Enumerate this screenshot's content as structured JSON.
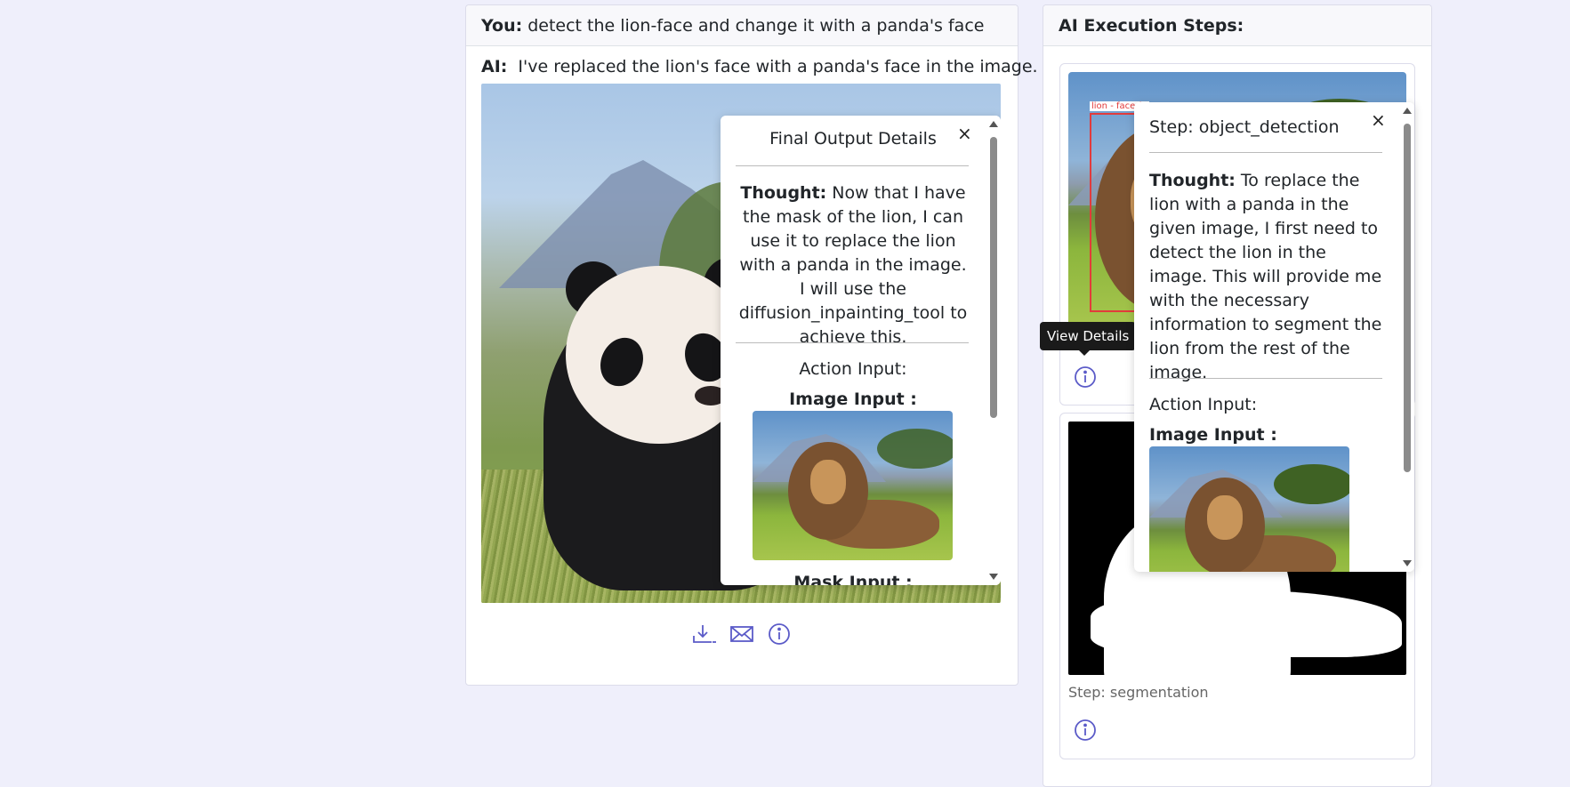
{
  "chat": {
    "user_label": "You:",
    "user_message": "detect the lion-face and change it with a panda's face",
    "ai_label": "AI:",
    "ai_message": "I've replaced the lion's face with a panda's face in the image.",
    "action_icons": [
      "download-icon",
      "mail-icon",
      "info-icon"
    ]
  },
  "final_popup": {
    "title": "Final Output Details",
    "close": "×",
    "thought_label": "Thought:",
    "thought_text": "Now that I have the mask of the lion, I can use it to replace the lion with a panda in the image. I will use the diffusion_inpainting_tool to achieve this.",
    "action_input_label": "Action Input:",
    "image_input_label": "Image Input :",
    "mask_input_label": "Mask Input :"
  },
  "steps_panel": {
    "header": "AI Execution Steps:",
    "detection_box_label": "lion - face (0",
    "tooltip": "View Details",
    "step2_label": "Step: segmentation"
  },
  "step_popup": {
    "title": "Step: object_detection",
    "close": "×",
    "thought_label": "Thought:",
    "thought_text": "To replace the lion with a panda in the given image, I first need to detect the lion in the image. This will provide me with the necessary information to segment the lion from the rest of the image.",
    "action_input_label": "Action Input:",
    "image_input_label": "Image Input :"
  },
  "colors": {
    "background": "#efeffb",
    "accent_icon": "#5b5bc8",
    "detection_box": "#e23b3b"
  }
}
